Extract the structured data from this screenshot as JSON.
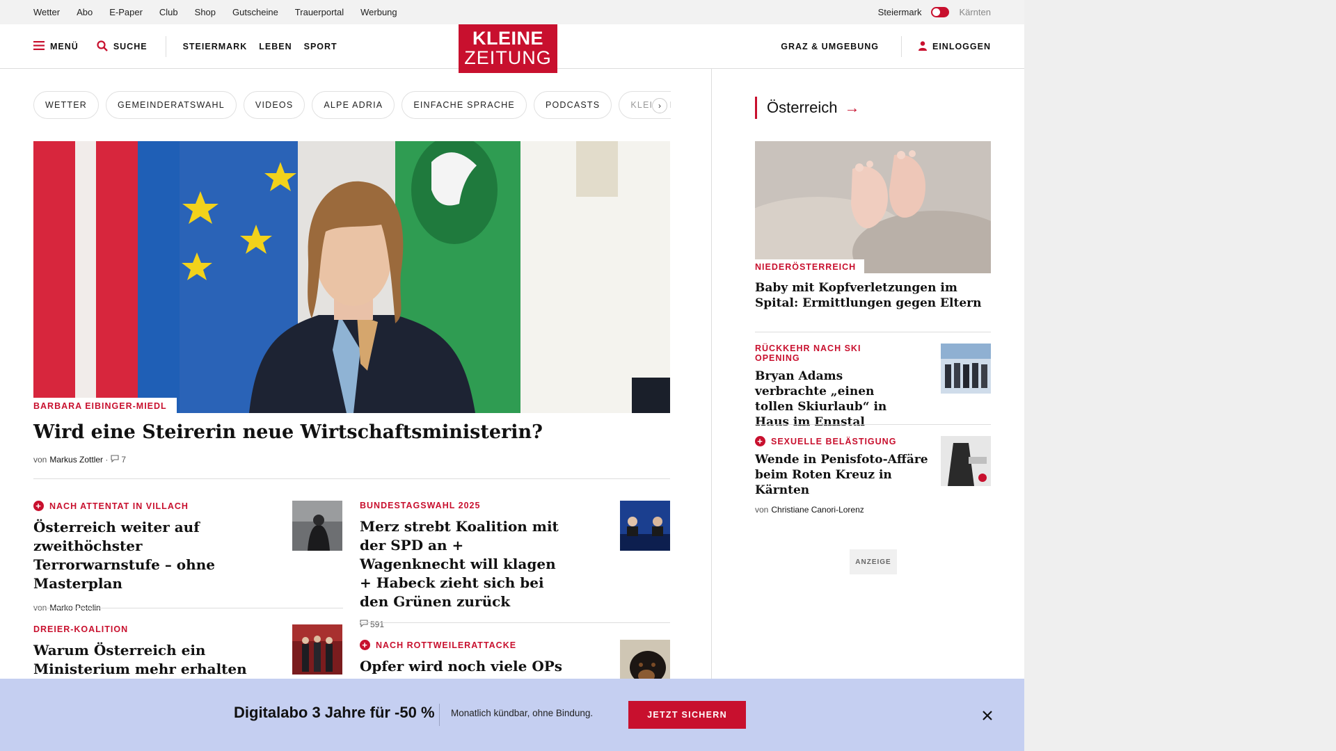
{
  "topbar": {
    "links": [
      "Wetter",
      "Abo",
      "E-Paper",
      "Club",
      "Shop",
      "Gutscheine",
      "Trauerportal",
      "Werbung"
    ],
    "region_left": "Steiermark",
    "region_right": "Kärnten"
  },
  "header": {
    "menu_label": "MENÜ",
    "search_label": "SUCHE",
    "nav": [
      "STEIERMARK",
      "LEBEN",
      "SPORT"
    ],
    "logo_line1": "KLEINE",
    "logo_line2": "ZEITUNG",
    "region_link": "GRAZ & UMGEBUNG",
    "login_label": "EINLOGGEN",
    "accent_color": "#c8102e"
  },
  "chips": [
    "WETTER",
    "GEMEINDERATSWAHL",
    "VIDEOS",
    "ALPE ADRIA",
    "EINFACHE SPRACHE",
    "PODCASTS",
    "KLEINE KI"
  ],
  "hero": {
    "kicker": "BARBARA EIBINGER-MIEDL",
    "title": "Wird eine Steirerin neue Wirtschaftsministerin?",
    "by": "von",
    "author": "Markus Zottler",
    "comments": "7"
  },
  "articles": [
    {
      "kicker": "NACH ATTENTAT IN VILLACH",
      "plus": true,
      "title": "Österreich weiter auf zweithöchster Terrorwarnstufe – ohne Masterplan",
      "by": "von",
      "author": "Marko Petelin"
    },
    {
      "kicker": "BUNDESTAGSWAHL 2025",
      "plus": false,
      "title": "Merz strebt Koalition mit der SPD an + Wagenknecht will klagen + Habeck zieht sich bei den Grünen zurück",
      "comments": "591"
    },
    {
      "kicker": "DREIER-KOALITION",
      "plus": false,
      "title": "Warum Österreich ein Ministerium mehr erhalten wird"
    },
    {
      "kicker": "NACH ROTTWEILERATTACKE",
      "plus": true,
      "title": "Opfer wird noch viele OPs brauchen"
    }
  ],
  "sidebar": {
    "heading": "Österreich",
    "items": [
      {
        "kicker": "NIEDERÖSTERREICH",
        "title": "Baby mit Kopfverletzungen im Spital: Ermittlungen gegen Eltern"
      },
      {
        "kicker": "RÜCKKEHR NACH SKI OPENING",
        "title": "Bryan Adams verbrachte „einen tollen Skiurlaub“ in Haus im Ennstal"
      },
      {
        "kicker": "SEXUELLE BELÄSTIGUNG",
        "plus": true,
        "title": "Wende in Penisfoto-Affäre beim Roten Kreuz in Kärnten",
        "by": "von",
        "author": "Christiane Canori-Lorenz"
      }
    ],
    "ad_label": "ANZEIGE"
  },
  "banner": {
    "title": "Digitalabo 3 Jahre für -50 %",
    "subtitle": "Monatlich kündbar, ohne Bindung.",
    "cta": "JETZT SICHERN",
    "background": "#c5cff1"
  }
}
